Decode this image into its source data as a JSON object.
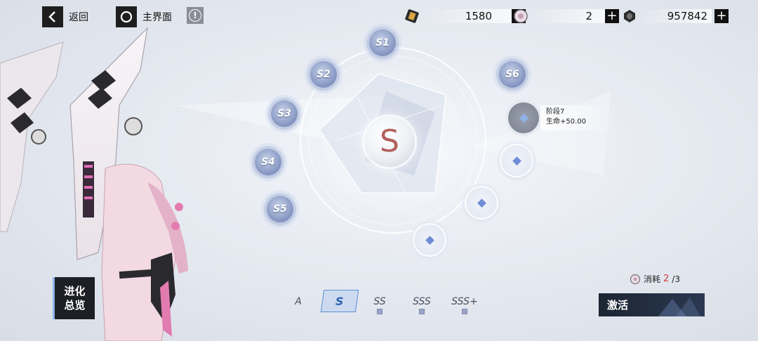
{
  "topbar": {
    "back_label": "返回",
    "home_label": "主界面",
    "info_glyph": "!"
  },
  "resources": [
    {
      "icon": "ticket-icon",
      "value": "1580"
    },
    {
      "icon": "chip-icon",
      "value": "2"
    },
    {
      "icon": "crystal-icon",
      "value": "957842"
    }
  ],
  "plus_glyph": "+",
  "center_rank": "S",
  "nodes": [
    {
      "label": "S1"
    },
    {
      "label": "S2"
    },
    {
      "label": "S3"
    },
    {
      "label": "S4"
    },
    {
      "label": "S5"
    },
    {
      "label": "S6"
    }
  ],
  "stage_info": {
    "stage": "阶段7",
    "bonus": "生命+50.00"
  },
  "evolution_button": {
    "line1": "进化",
    "line2": "总览"
  },
  "tiers": [
    "A",
    "S",
    "SS",
    "SSS",
    "SSS+"
  ],
  "selected_tier": "S",
  "cost": {
    "label": "消耗",
    "have": "2",
    "need": "/3"
  },
  "activate_label": "激活",
  "colors": {
    "accent": "#1f2a3a",
    "node": "#8797c2",
    "cost_red": "#d63a3a"
  }
}
